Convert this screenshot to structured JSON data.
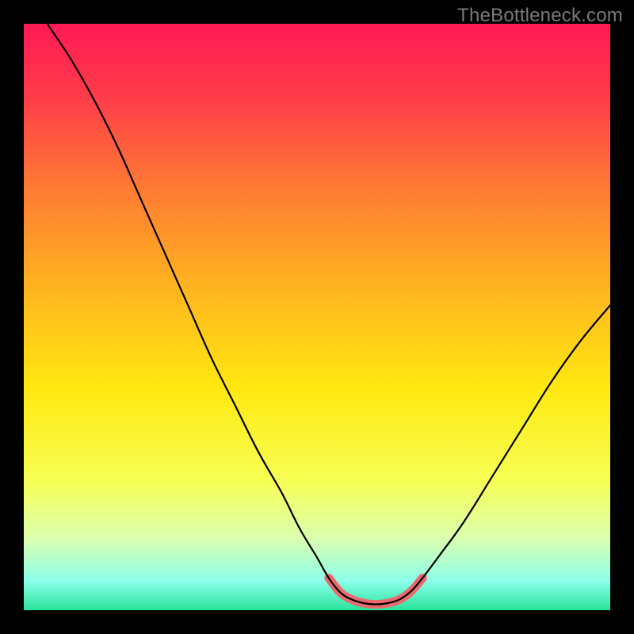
{
  "watermark": "TheBottleneck.com",
  "chart_data": {
    "type": "line",
    "title": "",
    "xlabel": "",
    "ylabel": "",
    "xlim": [
      0,
      100
    ],
    "ylim": [
      0,
      100
    ],
    "background_gradient_stops": [
      {
        "offset": 0.0,
        "color": "#ff1a55"
      },
      {
        "offset": 0.12,
        "color": "#ff3a4a"
      },
      {
        "offset": 0.28,
        "color": "#ff7a33"
      },
      {
        "offset": 0.45,
        "color": "#ffb41f"
      },
      {
        "offset": 0.62,
        "color": "#ffe80f"
      },
      {
        "offset": 0.78,
        "color": "#f7ff55"
      },
      {
        "offset": 0.88,
        "color": "#d9ffb0"
      },
      {
        "offset": 0.95,
        "color": "#8cffea"
      },
      {
        "offset": 1.0,
        "color": "#28e49a"
      }
    ],
    "series": [
      {
        "name": "curve",
        "stroke": "#000000",
        "stroke_width": 2.2,
        "points": [
          {
            "x": 4.0,
            "y": 100.0
          },
          {
            "x": 8.0,
            "y": 94.0
          },
          {
            "x": 12.0,
            "y": 87.0
          },
          {
            "x": 16.0,
            "y": 79.0
          },
          {
            "x": 20.0,
            "y": 70.0
          },
          {
            "x": 24.0,
            "y": 61.0
          },
          {
            "x": 28.0,
            "y": 52.0
          },
          {
            "x": 32.0,
            "y": 43.0
          },
          {
            "x": 36.0,
            "y": 35.0
          },
          {
            "x": 40.0,
            "y": 27.0
          },
          {
            "x": 44.0,
            "y": 20.0
          },
          {
            "x": 47.0,
            "y": 14.0
          },
          {
            "x": 50.0,
            "y": 9.0
          },
          {
            "x": 52.0,
            "y": 5.5
          },
          {
            "x": 54.0,
            "y": 3.0
          },
          {
            "x": 56.0,
            "y": 1.8
          },
          {
            "x": 58.0,
            "y": 1.2
          },
          {
            "x": 60.0,
            "y": 1.0
          },
          {
            "x": 62.0,
            "y": 1.2
          },
          {
            "x": 64.0,
            "y": 1.8
          },
          {
            "x": 66.0,
            "y": 3.2
          },
          {
            "x": 68.0,
            "y": 5.5
          },
          {
            "x": 71.0,
            "y": 9.5
          },
          {
            "x": 75.0,
            "y": 15.0
          },
          {
            "x": 80.0,
            "y": 23.0
          },
          {
            "x": 85.0,
            "y": 31.0
          },
          {
            "x": 90.0,
            "y": 39.0
          },
          {
            "x": 95.0,
            "y": 46.0
          },
          {
            "x": 100.0,
            "y": 52.0
          }
        ]
      },
      {
        "name": "bottom-highlight",
        "stroke": "#e96a6d",
        "stroke_width": 11,
        "linecap": "round",
        "points": [
          {
            "x": 52.0,
            "y": 5.5
          },
          {
            "x": 54.0,
            "y": 3.0
          },
          {
            "x": 56.0,
            "y": 1.8
          },
          {
            "x": 58.0,
            "y": 1.2
          },
          {
            "x": 60.0,
            "y": 1.0
          },
          {
            "x": 62.0,
            "y": 1.2
          },
          {
            "x": 64.0,
            "y": 1.8
          },
          {
            "x": 66.0,
            "y": 3.2
          },
          {
            "x": 68.0,
            "y": 5.5
          }
        ]
      }
    ]
  }
}
